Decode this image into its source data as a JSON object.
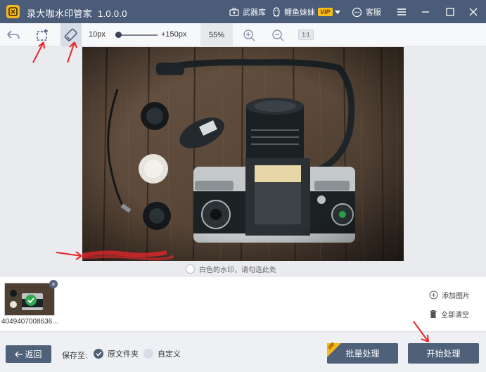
{
  "title_bar": {
    "app_name": "录大咖水印管家",
    "version": "1.0.0.0",
    "arsenal_label": "武器库",
    "user_name": "鲤鱼妹妹",
    "vip_badge": "VIP",
    "service_label": "客服"
  },
  "toolbar": {
    "min_size": "10px",
    "max_size": "+150px",
    "zoom_level": "55%",
    "ratio_label": "1:1"
  },
  "canvas": {
    "white_watermark_hint": "白色的水印，请勾选此处"
  },
  "files": {
    "thumbnail_name": "4049407008636...",
    "add_image_label": "添加图片",
    "clear_all_label": "全部清空"
  },
  "footer": {
    "back_label": "返回",
    "save_to_label": "保存至:",
    "option_original": "原文件夹",
    "option_custom": "自定义",
    "batch_label": "批量处理",
    "batch_vip": "VIP",
    "start_label": "开始处理"
  },
  "colors": {
    "title_bg": "#4a5c78",
    "button_bg": "#4f6079",
    "vip_gold": "#f5b819",
    "annotation_red": "#e8262c"
  }
}
